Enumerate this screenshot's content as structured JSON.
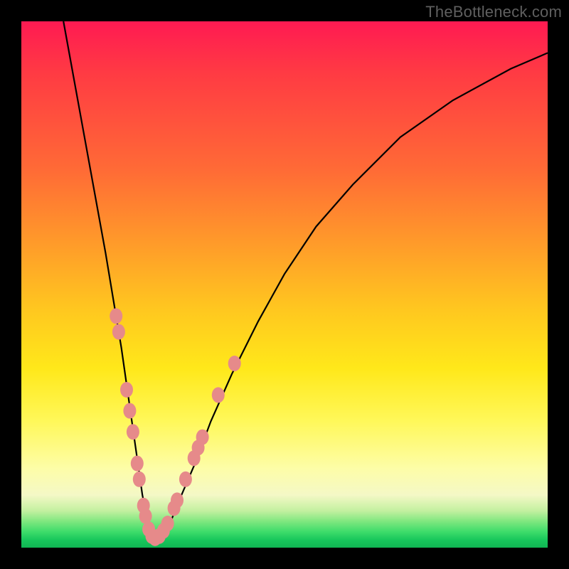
{
  "watermark": "TheBottleneck.com",
  "colors": {
    "frame": "#000000",
    "curve": "#000000",
    "dots": "#e68a8a",
    "gradient_top": "#ff1a52",
    "gradient_bottom": "#10b553"
  },
  "chart_data": {
    "type": "line",
    "title": "",
    "xlabel": "",
    "ylabel": "",
    "xlim": [
      0,
      100
    ],
    "ylim": [
      0,
      100
    ],
    "series": [
      {
        "name": "bottleneck-curve",
        "x": [
          8,
          10,
          12,
          14,
          16,
          18,
          19,
          20,
          21,
          22,
          23,
          24,
          25,
          26,
          28,
          30,
          33,
          36,
          40,
          45,
          50,
          56,
          63,
          72,
          82,
          93,
          100
        ],
        "y": [
          100,
          89,
          78,
          67,
          56,
          44,
          38,
          31,
          24,
          17,
          10,
          5,
          2,
          2,
          4,
          9,
          16,
          24,
          33,
          43,
          52,
          61,
          69,
          78,
          85,
          91,
          94
        ]
      }
    ],
    "scatter_points": {
      "name": "highlight-dots",
      "points": [
        {
          "x": 18.0,
          "y": 44
        },
        {
          "x": 18.5,
          "y": 41
        },
        {
          "x": 20.0,
          "y": 30
        },
        {
          "x": 20.6,
          "y": 26
        },
        {
          "x": 21.2,
          "y": 22
        },
        {
          "x": 22.0,
          "y": 16
        },
        {
          "x": 22.4,
          "y": 13
        },
        {
          "x": 23.2,
          "y": 8
        },
        {
          "x": 23.6,
          "y": 6
        },
        {
          "x": 24.2,
          "y": 3.5
        },
        {
          "x": 24.8,
          "y": 2.2
        },
        {
          "x": 25.4,
          "y": 1.8
        },
        {
          "x": 26.2,
          "y": 2.2
        },
        {
          "x": 27.0,
          "y": 3.2
        },
        {
          "x": 27.8,
          "y": 4.6
        },
        {
          "x": 29.0,
          "y": 7.5
        },
        {
          "x": 29.6,
          "y": 9
        },
        {
          "x": 31.2,
          "y": 13
        },
        {
          "x": 32.8,
          "y": 17
        },
        {
          "x": 33.6,
          "y": 19
        },
        {
          "x": 34.4,
          "y": 21
        },
        {
          "x": 37.4,
          "y": 29
        },
        {
          "x": 40.5,
          "y": 35
        }
      ]
    }
  }
}
